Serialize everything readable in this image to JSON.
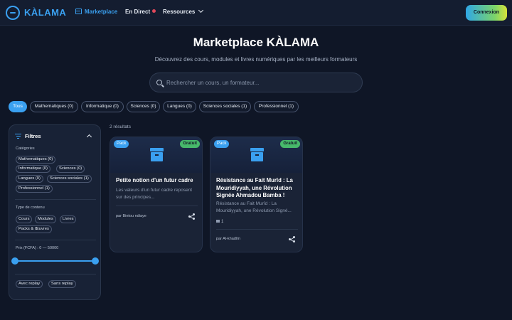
{
  "nav": {
    "logo": "KÀLAMA",
    "marketplace": "Marketplace",
    "live": "En Direct",
    "resources": "Ressources",
    "login": "Connexion"
  },
  "hero": {
    "title": "Marketplace KÀLAMA",
    "subtitle": "Découvrez des cours, modules et livres numériques par les meilleurs formateurs",
    "search_placeholder": "Rechercher un cours, un formateur..."
  },
  "categories": [
    {
      "label": "Tous",
      "active": true
    },
    {
      "label": "Mathematiques (0)"
    },
    {
      "label": "Informatique (0)"
    },
    {
      "label": "Sciences (0)"
    },
    {
      "label": "Langues (0)"
    },
    {
      "label": "Sciences sociales (1)"
    },
    {
      "label": "Professionnel (1)"
    }
  ],
  "sidebar": {
    "title": "Filtres",
    "categories_label": "Catégories",
    "categories": [
      "Mathematiques (0)",
      "Informatique (0)",
      "Sciences (0)",
      "Langues (0)",
      "Sciences sociales (1)",
      "Professionnel (1)"
    ],
    "content_type_label": "Type de contenu",
    "content_types": [
      "Cours",
      "Modules",
      "Livres",
      "Packs & Œuvres"
    ],
    "price_label": "Prix (FCFA) : 0 — 50000",
    "price_range": [
      0,
      50000
    ],
    "replay": [
      "Avec replay",
      "Sans replay"
    ]
  },
  "results": {
    "count": "2 résultats",
    "cards": [
      {
        "type_badge": "Pack",
        "price_badge": "Gratuit",
        "title": "Petite notion d'un futur cadre",
        "description": "Les valeurs d'un futur cadre reposent sur des principes...",
        "author": "par Bintou ndiaye"
      },
      {
        "type_badge": "Pack",
        "price_badge": "Gratuit",
        "title": "Résistance au Fait Murîd : La Mouridiyyah, une Révolution Signée Ahmadou Bamba !",
        "description": "Résistance au Fait Murîd : La Mouridiyyah, une Révolution Signé...",
        "media_count": "1",
        "author": "par Al-khadîm"
      }
    ]
  },
  "colors": {
    "background": "#0f1626",
    "accent": "#3aa0f0",
    "free_badge": "#47b86b"
  }
}
